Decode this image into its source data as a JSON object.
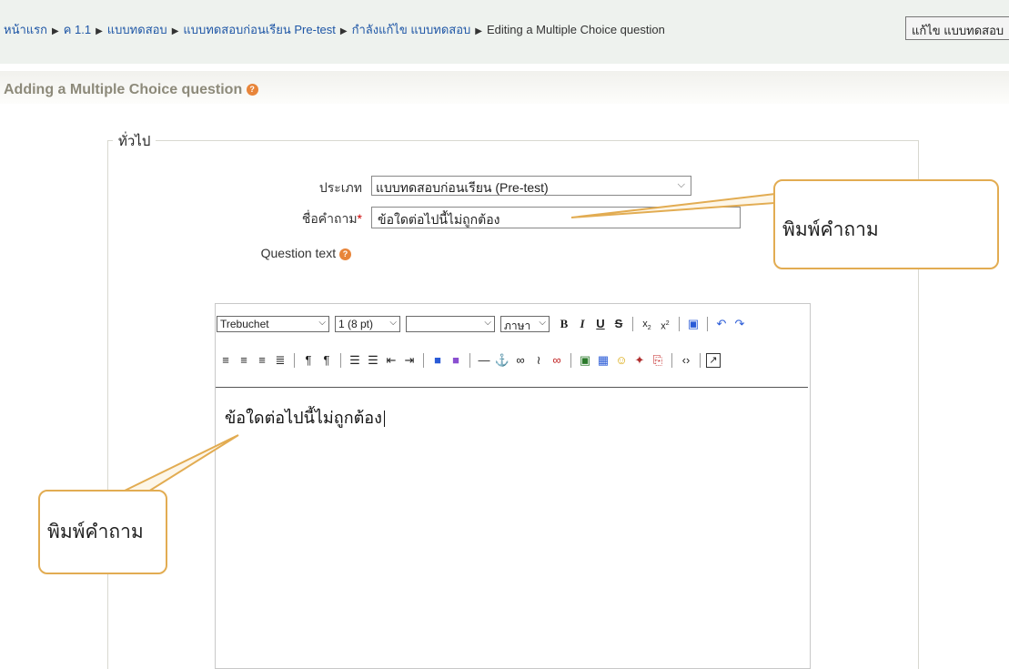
{
  "breadcrumb": {
    "items": [
      "หน้าแรก",
      "ค 1.1",
      "แบบทดสอบ",
      "แบบทดสอบก่อนเรียน Pre-test",
      "กำลังแก้ไข แบบทดสอบ"
    ],
    "current": "Editing a Multiple Choice question",
    "separator": "▶"
  },
  "header": {
    "edit_quiz_button": "แก้ไข แบบทดสอบ"
  },
  "page": {
    "heading": "Adding a Multiple Choice question",
    "help_glyph": "?"
  },
  "form": {
    "legend": "ทั่วไป",
    "category_label": "ประเภท",
    "category_value": "แบบทดสอบก่อนเรียน (Pre-test)",
    "name_label": "ชื่อคำถาม",
    "required_mark": "*",
    "name_value": "ข้อใดต่อไปนี้ไม่ถูกต้อง",
    "question_text_label": "Question text"
  },
  "editor": {
    "font_family": "Trebuchet",
    "font_size": "1 (8 pt)",
    "heading_value": "",
    "language": "ภาษา",
    "content": "ข้อใดต่อไปนี้ไม่ถูกต้อง"
  },
  "callouts": {
    "top_right": "พิมพ์คำถาม",
    "bottom_left": "พิมพ์คำถาม"
  },
  "colors": {
    "link": "#1e56a6",
    "callout_border": "#e2ac52",
    "help_icon": "#e8853a",
    "required": "#cc0000"
  }
}
